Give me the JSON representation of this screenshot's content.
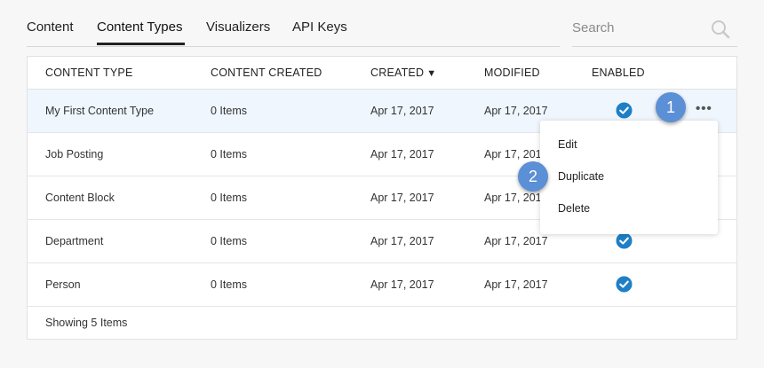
{
  "tabs": [
    {
      "label": "Content"
    },
    {
      "label": "Content Types"
    },
    {
      "label": "Visualizers"
    },
    {
      "label": "API Keys"
    }
  ],
  "active_tab": "Content Types",
  "search": {
    "placeholder": "Search"
  },
  "table": {
    "headers": [
      "CONTENT TYPE",
      "CONTENT CREATED",
      "CREATED",
      "MODIFIED",
      "ENABLED"
    ],
    "sort_indicator": "▼",
    "rows": [
      {
        "name": "My First Content Type",
        "created_count": "0 Items",
        "created": "Apr 17, 2017",
        "modified": "Apr 17, 2017",
        "enabled": true
      },
      {
        "name": "Job Posting",
        "created_count": "0 Items",
        "created": "Apr 17, 2017",
        "modified": "Apr 17, 2017",
        "enabled": true
      },
      {
        "name": "Content Block",
        "created_count": "0 Items",
        "created": "Apr 17, 2017",
        "modified": "Apr 17, 2017",
        "enabled": true
      },
      {
        "name": "Department",
        "created_count": "0 Items",
        "created": "Apr 17, 2017",
        "modified": "Apr 17, 2017",
        "enabled": true
      },
      {
        "name": "Person",
        "created_count": "0 Items",
        "created": "Apr 17, 2017",
        "modified": "Apr 17, 2017",
        "enabled": true
      }
    ],
    "footer": "Showing 5 Items"
  },
  "row_menu": {
    "dots": "•••",
    "items": [
      "Edit",
      "Duplicate",
      "Delete"
    ]
  },
  "badges": [
    "1",
    "2"
  ],
  "colors": {
    "accent": "#1e7fc6",
    "badge": "#5b8fd6",
    "row_highlight": "#eff6fd"
  }
}
